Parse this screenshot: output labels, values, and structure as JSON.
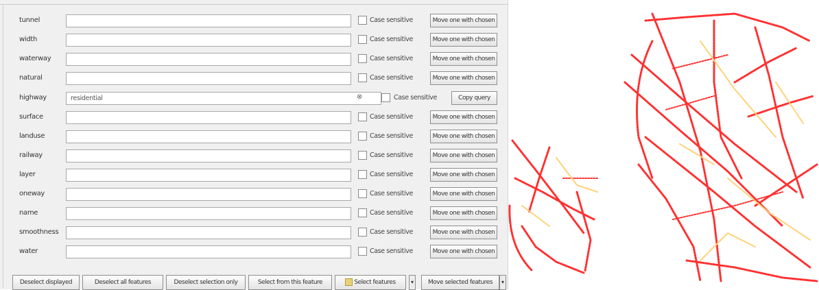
{
  "filters": [
    {
      "label": "tunnel",
      "value": "",
      "placeholder": "",
      "case_sensitive": "Case sensitive",
      "button": "Move one with chosen"
    },
    {
      "label": "width",
      "value": "",
      "placeholder": "",
      "case_sensitive": "Case sensitive",
      "button": "Move one with chosen"
    },
    {
      "label": "waterway",
      "value": "",
      "placeholder": "",
      "case_sensitive": "Case sensitive",
      "button": "Move one with chosen"
    },
    {
      "label": "natural",
      "value": "",
      "placeholder": "",
      "case_sensitive": "Case sensitive",
      "button": "Move one with chosen"
    },
    {
      "label": "highway",
      "value": "residential",
      "placeholder": "",
      "case_sensitive": "Case sensitive",
      "button": "Copy query",
      "clear_icon": "⊗"
    },
    {
      "label": "surface",
      "value": "",
      "placeholder": "",
      "case_sensitive": "Case sensitive",
      "button": "Move one with chosen"
    },
    {
      "label": "landuse",
      "value": "",
      "placeholder": "",
      "case_sensitive": "Case sensitive",
      "button": "Move one with chosen"
    },
    {
      "label": "railway",
      "value": "",
      "placeholder": "",
      "case_sensitive": "Case sensitive",
      "button": "Move one with chosen"
    },
    {
      "label": "layer",
      "value": "",
      "placeholder": "",
      "case_sensitive": "Case sensitive",
      "button": "Move one with chosen"
    },
    {
      "label": "oneway",
      "value": "",
      "placeholder": "",
      "case_sensitive": "Case sensitive",
      "button": "Move one with chosen"
    },
    {
      "label": "name",
      "value": "",
      "placeholder": "",
      "case_sensitive": "Case sensitive",
      "button": "Move one with chosen"
    },
    {
      "label": "smoothness",
      "value": "",
      "placeholder": "",
      "case_sensitive": "Case sensitive",
      "button": "Move one with chosen"
    },
    {
      "label": "water",
      "value": "",
      "placeholder": "",
      "case_sensitive": "Case sensitive",
      "button": "Move one with chosen"
    }
  ],
  "bottom_bar": {
    "b1": "Deselect displayed",
    "b2": "Deselect all features",
    "b3": "Deselect selection only",
    "b4": "Select from this feature",
    "b5": "Select features",
    "b6": "Move selected features"
  },
  "colors": {
    "road": "#ff2222",
    "road_minor": "#ffd27a",
    "panel": "#f0f0f0"
  }
}
